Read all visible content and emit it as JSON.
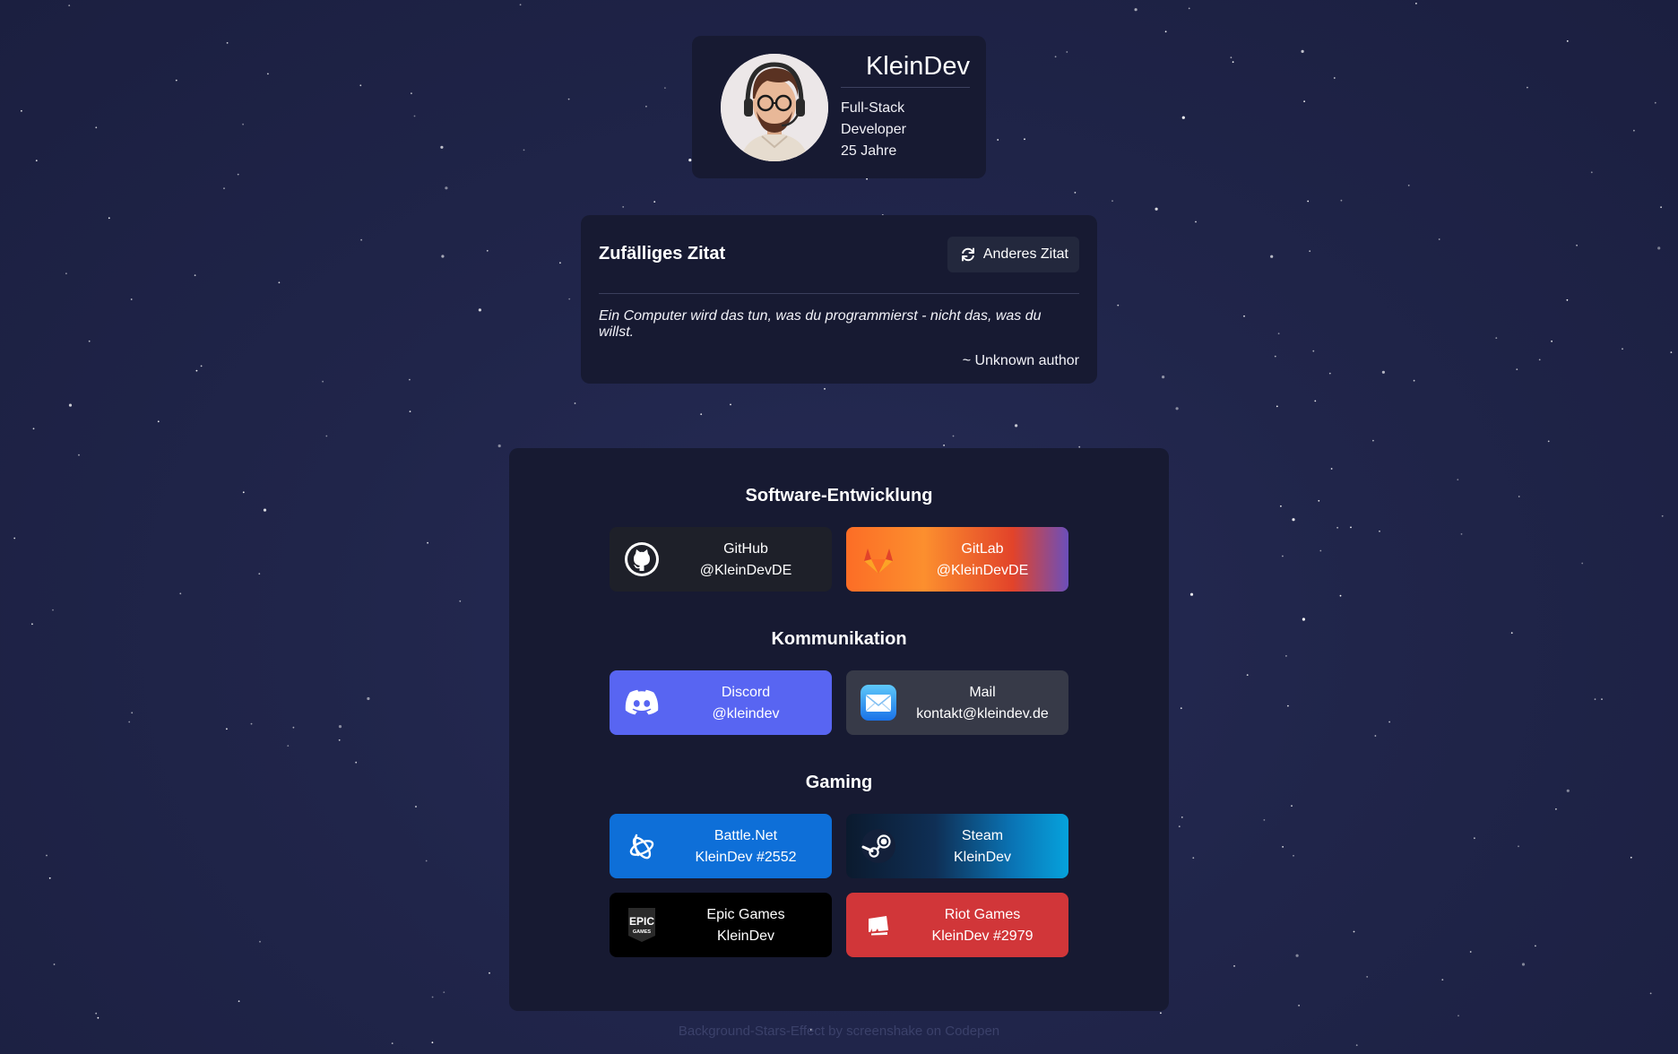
{
  "profile": {
    "name": "KleinDev",
    "role": "Full-Stack Developer",
    "age": "25 Jahre"
  },
  "quote": {
    "title": "Zufälliges Zitat",
    "button_label": "Anderes Zitat",
    "text": "Ein Computer wird das tun, was du programmierst - nicht das, was du willst.",
    "author": "~ Unknown author"
  },
  "sections": {
    "software": {
      "title": "Software-Entwicklung",
      "github": {
        "service": "GitHub",
        "handle": "@KleinDevDE",
        "icon": "github-icon"
      },
      "gitlab": {
        "service": "GitLab",
        "handle": "@KleinDevDE",
        "icon": "gitlab-icon"
      }
    },
    "communication": {
      "title": "Kommunikation",
      "discord": {
        "service": "Discord",
        "handle": "@kleindev",
        "icon": "discord-icon"
      },
      "mail": {
        "service": "Mail",
        "handle": "kontakt@kleindev.de",
        "icon": "mail-icon"
      }
    },
    "gaming": {
      "title": "Gaming",
      "battlenet": {
        "service": "Battle.Net",
        "handle": "KleinDev #2552",
        "icon": "battlenet-icon"
      },
      "steam": {
        "service": "Steam",
        "handle": "KleinDev",
        "icon": "steam-icon"
      },
      "epic": {
        "service": "Epic Games",
        "handle": "KleinDev",
        "icon": "epic-games-icon"
      },
      "riot": {
        "service": "Riot Games",
        "handle": "KleinDev #2979",
        "icon": "riot-games-icon"
      }
    }
  },
  "colors": {
    "background": "#20254a",
    "card": "#171a32",
    "github": "#1e2029",
    "gitlab_start": "#fc6d26",
    "gitlab_end": "#6b4fbb",
    "discord": "#5865f2",
    "mail": "#373a48",
    "battlenet": "#0e6fd8",
    "steam_start": "#0b1a2e",
    "steam_end": "#06a2dc",
    "epic": "#000000",
    "riot": "#d13639"
  },
  "footer": "Background-Stars-Effect by screenshake on Codepen"
}
